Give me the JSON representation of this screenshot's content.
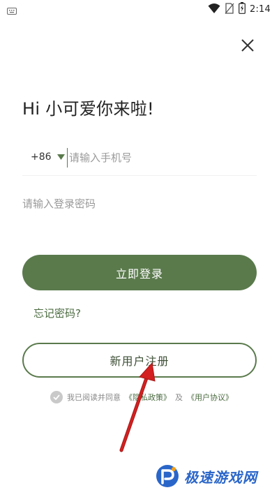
{
  "status_bar": {
    "time": "2:14",
    "icons": [
      "keyboard-icon",
      "wifi-icon",
      "no-sim-icon",
      "battery-icon"
    ]
  },
  "close_icon": "close-icon",
  "greeting": "Hi 小可爱你来啦!",
  "phone": {
    "country_code": "+86",
    "dropdown_icon": "triangle-down-icon",
    "placeholder": "请输入手机号",
    "value": ""
  },
  "password": {
    "placeholder": "请输入登录密码",
    "value": ""
  },
  "login_button": "立即登录",
  "forgot_password": "忘记密码?",
  "register_button": "新用户注册",
  "agreement": {
    "checked": true,
    "prefix": "我已阅读并同意",
    "privacy_link": "《隐私政策》",
    "and": "及",
    "user_link": "《用户协议》"
  },
  "watermark": {
    "text": "极速游戏网",
    "logo": "brand-logo-icon"
  },
  "colors": {
    "accent": "#5a7a4c",
    "annotation_arrow": "#d42020",
    "watermark_blue": "#2a66c9"
  }
}
